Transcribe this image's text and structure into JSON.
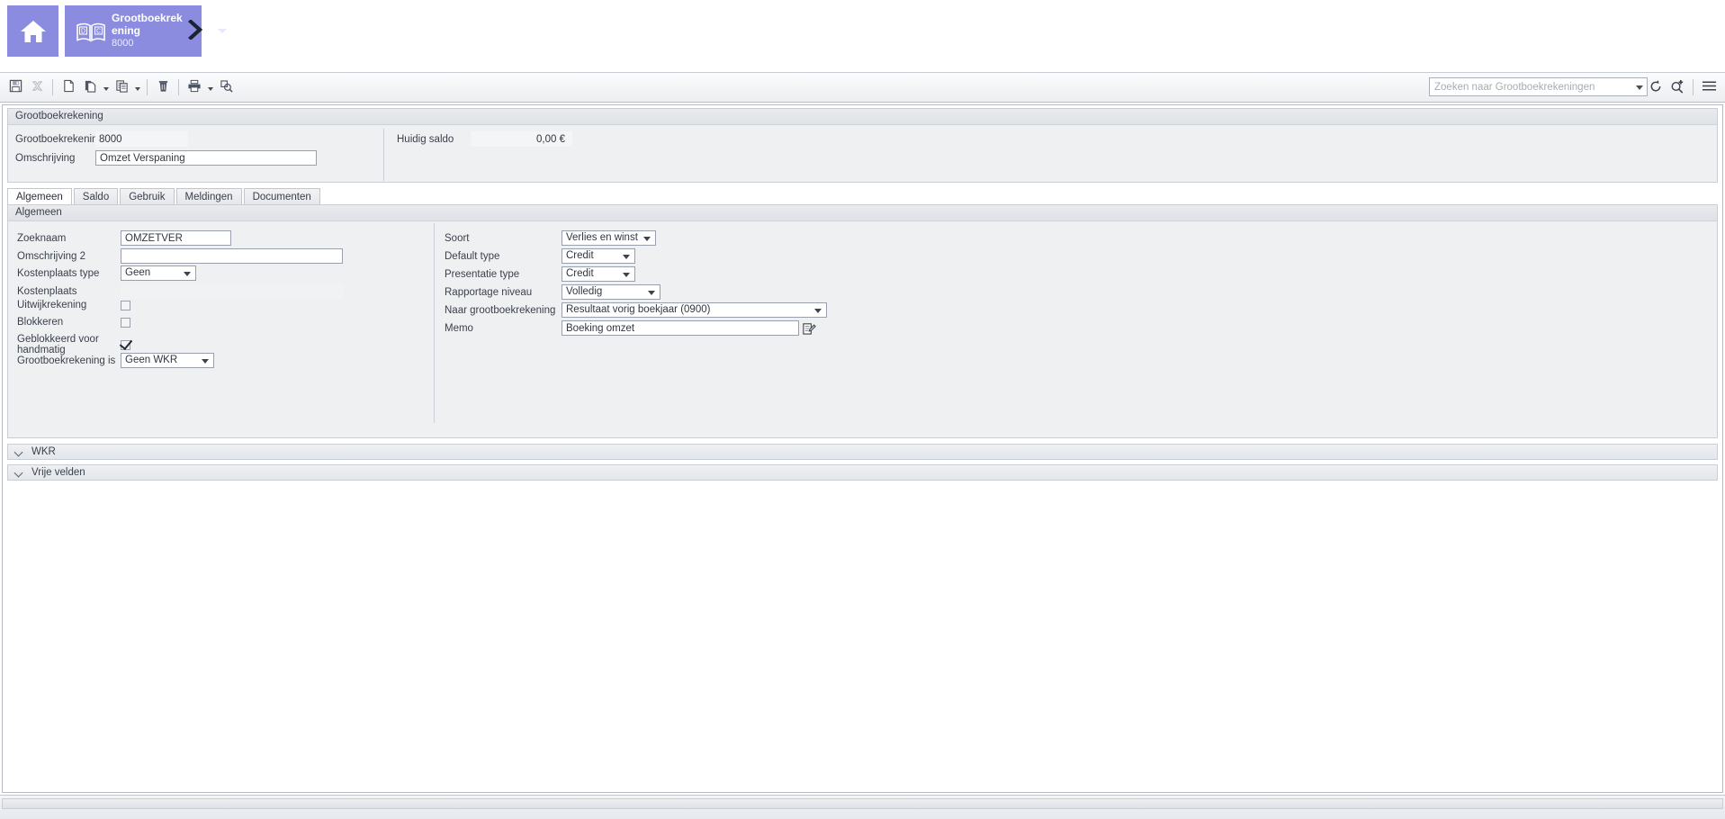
{
  "topbar": {
    "home_label": "Home",
    "doc_tab": {
      "title": "Grootboekrekening",
      "number": "8000"
    },
    "next_arrow_label": "Volgende"
  },
  "toolbar": {
    "buttons": [
      {
        "name": "save-button",
        "label": "Opslaan",
        "icon": "save-icon",
        "disabled": false
      },
      {
        "name": "cancel-button",
        "label": "Annuleren",
        "icon": "cancel-x-icon",
        "disabled": true
      },
      {
        "name": "new-button",
        "label": "Nieuw",
        "icon": "new-document-icon",
        "disabled": false
      },
      {
        "name": "copy-button",
        "label": "Kopieren",
        "icon": "copy-icon",
        "disabled": false
      },
      {
        "name": "paste-button",
        "label": "Plakken",
        "icon": "paste-icon",
        "disabled": false
      },
      {
        "name": "delete-button",
        "label": "Verwijderen",
        "icon": "trash-icon",
        "disabled": false
      },
      {
        "name": "print-button",
        "label": "Afdrukken",
        "icon": "printer-icon",
        "disabled": false
      },
      {
        "name": "print-preview-button",
        "label": "Afdrukvoorbeeld",
        "icon": "print-preview-icon",
        "disabled": false
      }
    ],
    "search": {
      "placeholder": "Zoeken naar Grootboekrekeningen",
      "value": ""
    },
    "right_icons": [
      {
        "name": "refresh-icon",
        "label": "Vernieuwen"
      },
      {
        "name": "search-add-icon",
        "label": "Nieuwe zoekopdracht"
      },
      {
        "name": "hamburger-menu-icon",
        "label": "Menu"
      }
    ]
  },
  "header_panel": {
    "caption": "Grootboekrekening",
    "fields": {
      "grootboekrekening_label": "Grootboekrekening",
      "grootboekrekening_value": "8000",
      "omschrijving_label": "Omschrijving",
      "omschrijving_value": "Omzet Verspaning",
      "huidig_saldo_label": "Huidig saldo",
      "huidig_saldo_value": "0,00 €"
    }
  },
  "tabs": [
    {
      "label": "Algemeen",
      "active": true
    },
    {
      "label": "Saldo",
      "active": false
    },
    {
      "label": "Gebruik",
      "active": false
    },
    {
      "label": "Meldingen",
      "active": false
    },
    {
      "label": "Documenten",
      "active": false
    }
  ],
  "general_group": {
    "caption": "Algemeen",
    "left": {
      "zoeknaam_label": "Zoeknaam",
      "zoeknaam_value": "OMZETVER",
      "omschrijving2_label": "Omschrijving 2",
      "omschrijving2_value": "",
      "kostenplaats_type_label": "Kostenplaats type",
      "kostenplaats_type_value": "Geen",
      "kostenplaats_label": "Kostenplaats",
      "kostenplaats_value": "",
      "uitwijkrekening_label": "Uitwijkrekening",
      "uitwijkrekening_checked": false,
      "blokkeren_label": "Blokkeren",
      "blokkeren_checked": false,
      "geblokkeerd_handmatig_label": "Geblokkeerd voor handmatig",
      "geblokkeerd_handmatig_checked": true,
      "grootboekrekening_is_label": "Grootboekrekening is",
      "grootboekrekening_is_value": "Geen WKR"
    },
    "right": {
      "soort_label": "Soort",
      "soort_value": "Verlies en winst",
      "default_type_label": "Default type",
      "default_type_value": "Credit",
      "presentatie_type_label": "Presentatie type",
      "presentatie_type_value": "Credit",
      "rapportage_niveau_label": "Rapportage niveau",
      "rapportage_niveau_value": "Volledig",
      "naar_grootboekrekening_label": "Naar grootboekrekening",
      "naar_grootboekrekening_value": "Resultaat vorig boekjaar (0900)",
      "memo_label": "Memo",
      "memo_value": "Boeking omzet"
    }
  },
  "sections": [
    {
      "label": "WKR",
      "expanded": false
    },
    {
      "label": "Vrije velden",
      "expanded": false
    }
  ],
  "colors": {
    "accent_purple": "#8b8ce0",
    "panel_gray": "#eef0f2",
    "border_gray": "#c9ced6",
    "text": "#3a3f4b"
  }
}
